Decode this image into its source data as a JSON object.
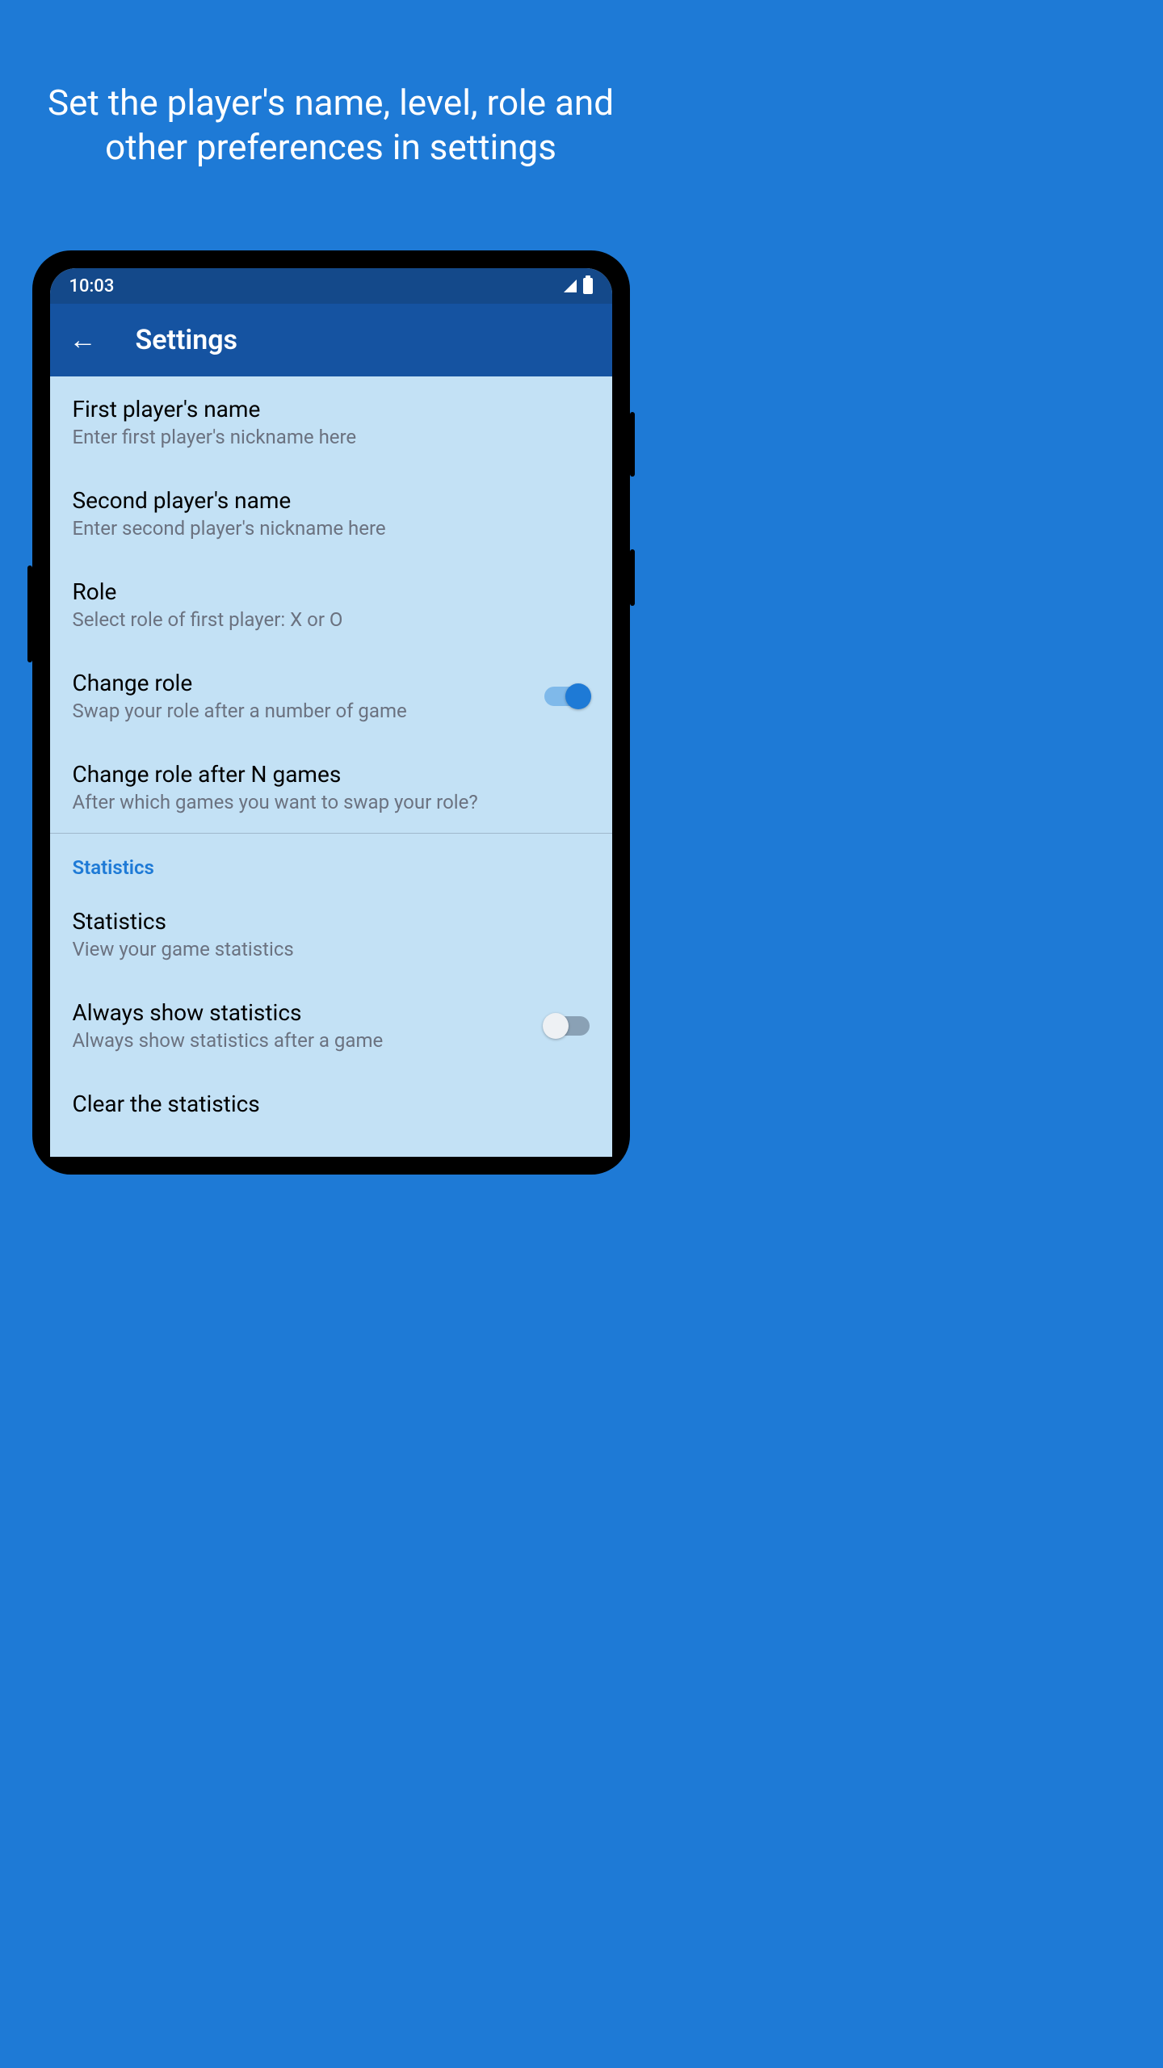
{
  "promo": "Set the player's name, level, role and other preferences in settings",
  "status": {
    "time": "10:03"
  },
  "appbar": {
    "title": "Settings"
  },
  "settings": [
    {
      "title": "First player's name",
      "subtitle": "Enter first player's nickname here"
    },
    {
      "title": "Second player's name",
      "subtitle": "Enter second player's nickname here"
    },
    {
      "title": "Role",
      "subtitle": "Select role of first player: X or O"
    },
    {
      "title": "Change role",
      "subtitle": "Swap your role after a number of game"
    },
    {
      "title": "Change role after N games",
      "subtitle": "After which games you want to swap your role?"
    }
  ],
  "section": {
    "header": "Statistics"
  },
  "stats": [
    {
      "title": "Statistics",
      "subtitle": "View your game statistics"
    },
    {
      "title": "Always show statistics",
      "subtitle": "Always show statistics after a game"
    },
    {
      "title": "Clear the statistics",
      "subtitle": ""
    }
  ]
}
